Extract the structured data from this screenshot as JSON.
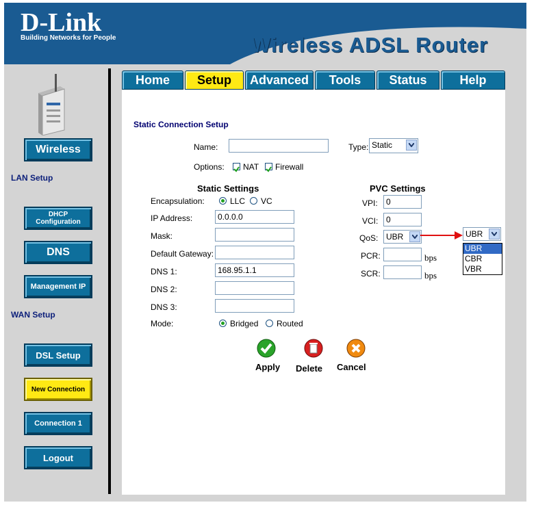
{
  "brand": {
    "logo": "D-Link",
    "tagline": "Building Networks for People",
    "product": "Wireless ADSL Router"
  },
  "tabs": [
    {
      "label": "Home",
      "active": false
    },
    {
      "label": "Setup",
      "active": true
    },
    {
      "label": "Advanced",
      "active": false
    },
    {
      "label": "Tools",
      "active": false
    },
    {
      "label": "Status",
      "active": false
    },
    {
      "label": "Help",
      "active": false
    }
  ],
  "sidebar": {
    "wireless": "Wireless",
    "lan_setup": "LAN Setup",
    "dhcp": "DHCP Configuration",
    "dns": "DNS",
    "management_ip": "Management IP",
    "wan_setup": "WAN Setup",
    "dsl_setup": "DSL Setup",
    "new_connection": "New Connection",
    "connection1": "Connection 1",
    "logout": "Logout"
  },
  "form": {
    "title": "Static Connection Setup",
    "name_label": "Name:",
    "name_value": "",
    "type_label": "Type:",
    "type_value": "Static",
    "options_label": "Options:",
    "nat_label": "NAT",
    "nat_checked": true,
    "firewall_label": "Firewall",
    "firewall_checked": true,
    "static_header": "Static Settings",
    "encap_label": "Encapsulation:",
    "llc_label": "LLC",
    "vc_label": "VC",
    "encap_value": "LLC",
    "ip_label": "IP Address:",
    "ip_value": "0.0.0.0",
    "mask_label": "Mask:",
    "mask_value": "",
    "gw_label": "Default Gateway:",
    "gw_value": "",
    "dns1_label": "DNS 1:",
    "dns1_value": "168.95.1.1",
    "dns2_label": "DNS 2:",
    "dns2_value": "",
    "dns3_label": "DNS 3:",
    "dns3_value": "",
    "mode_label": "Mode:",
    "bridged_label": "Bridged",
    "routed_label": "Routed",
    "mode_value": "Bridged",
    "pvc_header": "PVC Settings",
    "vpi_label": "VPI:",
    "vpi_value": "0",
    "vci_label": "VCI:",
    "vci_value": "0",
    "qos_label": "QoS:",
    "qos_value": "UBR",
    "pcr_label": "PCR:",
    "pcr_value": "",
    "pcr_unit": "bps",
    "scr_label": "SCR:",
    "scr_value": "",
    "scr_unit": "bps"
  },
  "qos_dropdown": {
    "value": "UBR",
    "options": [
      "UBR",
      "CBR",
      "VBR"
    ],
    "highlighted": "UBR"
  },
  "actions": {
    "apply": "Apply",
    "delete": "Delete",
    "cancel": "Cancel"
  },
  "colors": {
    "brand_blue": "#1a5b92",
    "button_blue": "#0e6f9c",
    "active_yellow": "#ffe914",
    "arrow_red": "#e01010"
  }
}
